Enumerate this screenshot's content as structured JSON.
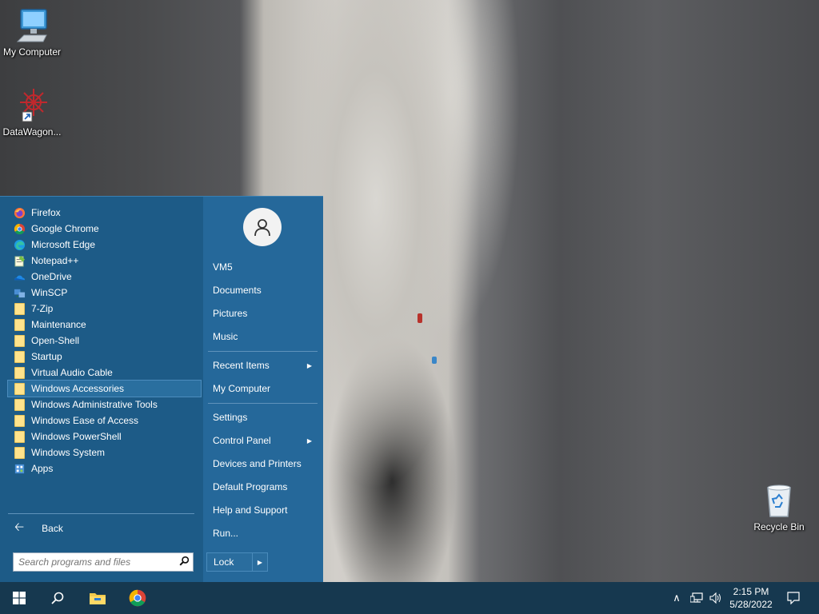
{
  "desktop": {
    "icons": [
      {
        "label": "My Computer"
      },
      {
        "label": "DataWagon..."
      },
      {
        "label": "Recycle Bin"
      }
    ]
  },
  "start_menu": {
    "programs": [
      {
        "label": "Firefox",
        "icon": "firefox-icon"
      },
      {
        "label": "Google Chrome",
        "icon": "chrome-icon"
      },
      {
        "label": "Microsoft Edge",
        "icon": "edge-icon"
      },
      {
        "label": "Notepad++",
        "icon": "notepadpp-icon"
      },
      {
        "label": "OneDrive",
        "icon": "onedrive-icon"
      },
      {
        "label": "WinSCP",
        "icon": "winscp-icon"
      },
      {
        "label": "7-Zip",
        "icon": "folder-icon"
      },
      {
        "label": "Maintenance",
        "icon": "folder-icon"
      },
      {
        "label": "Open-Shell",
        "icon": "folder-icon"
      },
      {
        "label": "Startup",
        "icon": "folder-icon"
      },
      {
        "label": "Virtual Audio Cable",
        "icon": "folder-icon"
      },
      {
        "label": "Windows Accessories",
        "icon": "folder-icon",
        "selected": true
      },
      {
        "label": "Windows Administrative Tools",
        "icon": "folder-icon"
      },
      {
        "label": "Windows Ease of Access",
        "icon": "folder-icon"
      },
      {
        "label": "Windows PowerShell",
        "icon": "folder-icon"
      },
      {
        "label": "Windows System",
        "icon": "folder-icon"
      },
      {
        "label": "Apps",
        "icon": "apps-icon"
      }
    ],
    "back_label": "Back",
    "search_placeholder": "Search programs and files",
    "right_items": [
      {
        "label": "VM5"
      },
      {
        "label": "Documents"
      },
      {
        "label": "Pictures"
      },
      {
        "label": "Music"
      },
      {
        "label": "Recent Items",
        "submenu": true
      },
      {
        "label": "My Computer"
      },
      {
        "label": "Settings"
      },
      {
        "label": "Control Panel",
        "submenu": true
      },
      {
        "label": "Devices and Printers"
      },
      {
        "label": "Default Programs"
      },
      {
        "label": "Help and Support"
      },
      {
        "label": "Run..."
      }
    ],
    "lock_label": "Lock"
  },
  "taskbar": {
    "time": "2:15 PM",
    "date": "5/28/2022"
  },
  "colors": {
    "menu_left": "#1d5b87",
    "menu_right": "#25689a",
    "taskbar": "#16384f",
    "selection": "#2a6f9f"
  }
}
